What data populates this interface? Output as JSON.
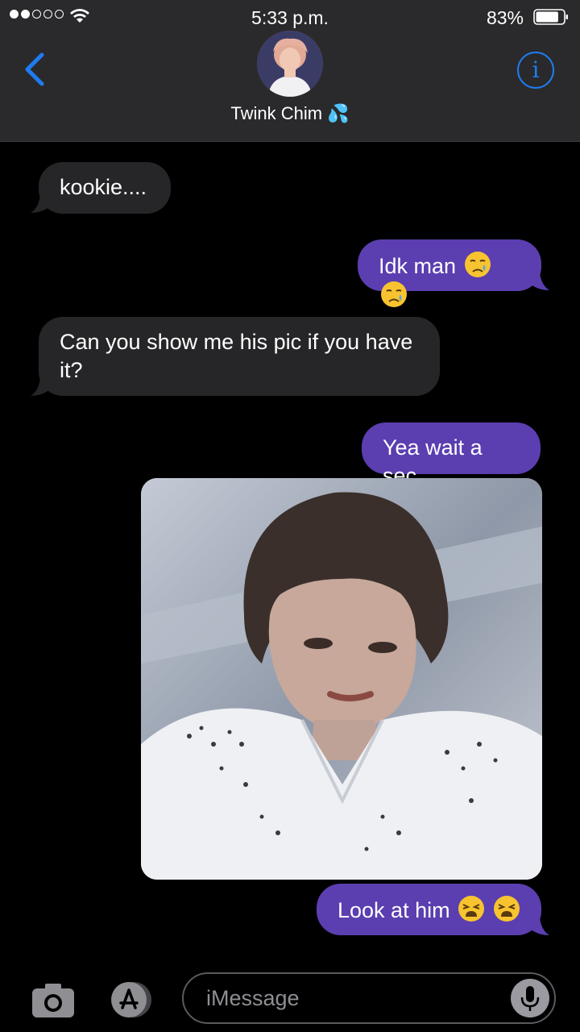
{
  "status_bar": {
    "time": "5:33 p.m.",
    "battery_percent": "83%",
    "battery_level": 0.83,
    "signal_bars_filled": 2,
    "signal_bars_total": 5
  },
  "header": {
    "contact_name": "Twink Chim 💦",
    "back_icon": "chevron-left-icon",
    "info_icon": "info-icon",
    "info_glyph": "i"
  },
  "messages": [
    {
      "direction": "incoming",
      "text": "kookie...."
    },
    {
      "direction": "outgoing",
      "text": "Idk man",
      "emojis": [
        "crying-face",
        "crying-face"
      ]
    },
    {
      "direction": "incoming",
      "line1": "Can you show me his pic if you have",
      "line2": "it?"
    },
    {
      "direction": "outgoing",
      "text": "Yea wait a sec"
    },
    {
      "direction": "outgoing",
      "type": "photo",
      "description_icon": "photo-attachment"
    },
    {
      "direction": "outgoing",
      "text": "Look at him",
      "emojis": [
        "tired-face",
        "tired-face"
      ]
    }
  ],
  "input_bar": {
    "placeholder": "iMessage",
    "camera_icon": "camera-icon",
    "apps_icon": "app-store-icon",
    "mic_icon": "microphone-icon"
  },
  "colors": {
    "header_bg": "#2a2a2c",
    "incoming_bubble": "#262628",
    "outgoing_bubble": "#5b3eb0",
    "accent_blue": "#1e7cf2",
    "background": "#000000"
  }
}
